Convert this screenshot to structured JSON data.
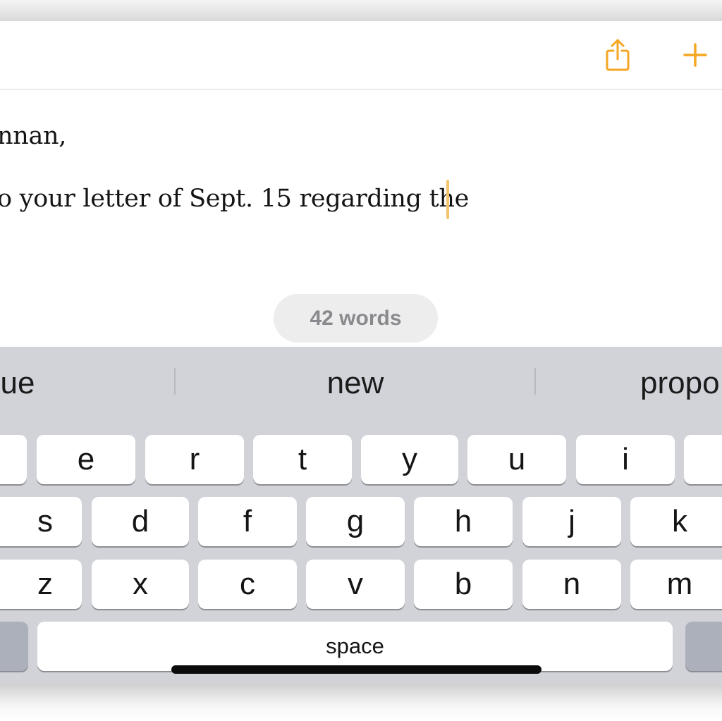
{
  "toolbar": {
    "share_icon": "share-icon",
    "add_icon": "plus-icon",
    "accent_color": "#f5a623"
  },
  "document": {
    "line1": "nnan,",
    "line2": "o your letter of Sept. 15 regarding the",
    "word_count": "42 words"
  },
  "keyboard": {
    "predictions": [
      "ue",
      "new",
      "propo"
    ],
    "row1": [
      "e",
      "r",
      "t",
      "y",
      "u",
      "i"
    ],
    "row2": [
      "s",
      "d",
      "f",
      "g",
      "h",
      "j",
      "k"
    ],
    "row3": [
      "z",
      "x",
      "c",
      "v",
      "b",
      "n",
      "m"
    ],
    "space_label": "space"
  }
}
